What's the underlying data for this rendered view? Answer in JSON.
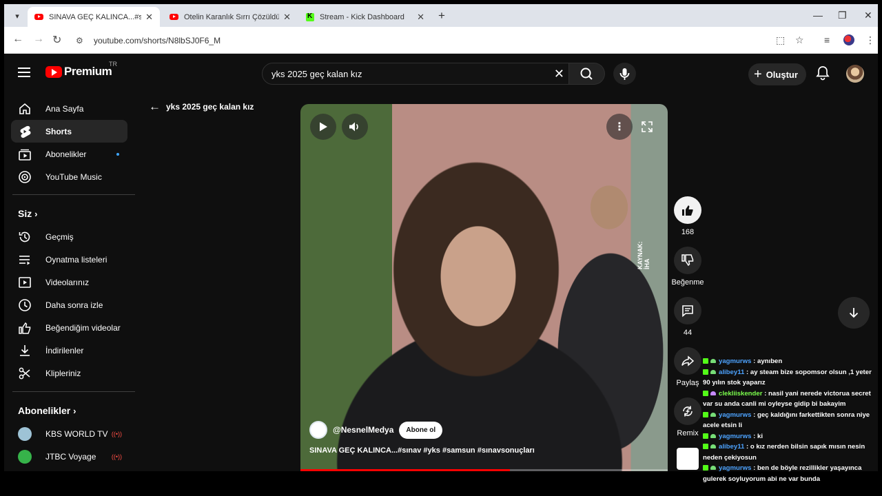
{
  "browser": {
    "tabs": [
      {
        "title": "SINAVA GEÇ KALINCA...#sınav #",
        "active": true,
        "favicon": "youtube"
      },
      {
        "title": "Otelin Karanlık Sırrı Çözüldü! 😱",
        "active": false,
        "favicon": "youtube"
      },
      {
        "title": "Stream - Kick Dashboard",
        "active": false,
        "favicon": "kick"
      }
    ],
    "url": "youtube.com/shorts/N8lbSJ0F6_M"
  },
  "header": {
    "logo_text": "Premium",
    "country": "TR",
    "search_value": "yks 2025 geç kalan kız",
    "create_label": "Oluştur"
  },
  "sidebar": {
    "main": [
      {
        "label": "Ana Sayfa",
        "icon": "home-icon"
      },
      {
        "label": "Shorts",
        "icon": "shorts-icon",
        "active": true
      },
      {
        "label": "Abonelikler",
        "icon": "subscriptions-icon",
        "dot": true
      },
      {
        "label": "YouTube Music",
        "icon": "music-icon"
      }
    ],
    "you_heading": "Siz",
    "you": [
      {
        "label": "Geçmiş",
        "icon": "history-icon"
      },
      {
        "label": "Oynatma listeleri",
        "icon": "playlist-icon"
      },
      {
        "label": "Videolarınız",
        "icon": "your-videos-icon"
      },
      {
        "label": "Daha sonra izle",
        "icon": "clock-icon"
      },
      {
        "label": "Beğendiğim videolar",
        "icon": "thumb-up-icon"
      },
      {
        "label": "İndirilenler",
        "icon": "download-icon"
      },
      {
        "label": "Klipleriniz",
        "icon": "scissors-icon"
      }
    ],
    "subs_heading": "Abonelikler",
    "subs": [
      {
        "label": "KBS WORLD TV",
        "color": "#9ec3d6"
      },
      {
        "label": "JTBC Voyage",
        "color": "#36b34a"
      }
    ]
  },
  "shorts": {
    "back_label": "yks 2025 geç kalan kız",
    "channel": "@NesnelMedya",
    "subscribe": "Abone ol",
    "caption": "SINAVA GEÇ KALINCA...#sınav #yks #samsun #sınavsonuçları",
    "watermark": "KAYNAK: İHA",
    "progress": 0.57,
    "likes": "168",
    "dislike_label": "Beğenme",
    "comments": "44",
    "share_label": "Paylaş",
    "remix_label": "Remix"
  },
  "chat": [
    {
      "user": "yagmurws",
      "text": ": aynıben",
      "green": false
    },
    {
      "user": "alibey11",
      "text": ": ay steam bize sopomsor olsun ,1 yeter 90 yılın stok yaparız",
      "green": false
    },
    {
      "user": "clekliiskender",
      "text": ": nasil yani nerede victorua secret var su anda canli mi oyleyse gidip bi bakayim",
      "green": true
    },
    {
      "user": "yagmurws",
      "text": ": geç kaldığını farkettikten sonra niye acele etsin li",
      "green": false
    },
    {
      "user": "yagmurws",
      "text": ": ki",
      "green": false
    },
    {
      "user": "alibey11",
      "text": ": o kız nerden bilsin sapık mısın nesin neden çekiyosun",
      "green": false
    },
    {
      "user": "yagmurws",
      "text": ": ben de böyle rezillikler yaşayınca gulerek soyluyorum abi ne var bunda",
      "green": false
    }
  ]
}
